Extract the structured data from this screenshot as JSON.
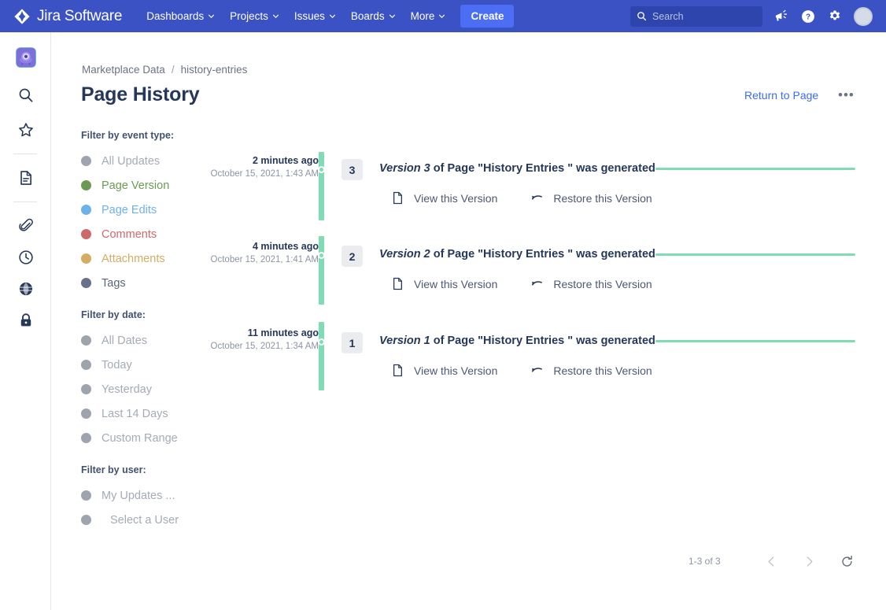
{
  "topnav": {
    "brand": "Jira Software",
    "logo_icon": "jira-diamond-logo",
    "items": [
      {
        "label": "Dashboards",
        "icon": "chevron-down-icon"
      },
      {
        "label": "Projects",
        "icon": "chevron-down-icon"
      },
      {
        "label": "Issues",
        "icon": "chevron-down-icon"
      },
      {
        "label": "Boards",
        "icon": "chevron-down-icon"
      },
      {
        "label": "More",
        "icon": "chevron-down-icon"
      }
    ],
    "create_label": "Create",
    "search": {
      "placeholder": "Search",
      "icon": "search-icon"
    },
    "right_icons": [
      {
        "name": "announcements-icon"
      },
      {
        "name": "help-icon"
      },
      {
        "name": "settings-gear-icon"
      },
      {
        "name": "user-avatar"
      }
    ],
    "bg_color": "#3a52c4",
    "create_color": "#4c6ef5"
  },
  "rail": {
    "app_logo": "app-logo",
    "items": [
      {
        "name": "search-icon"
      },
      {
        "name": "star-icon"
      },
      {
        "name": "divider"
      },
      {
        "name": "document-icon"
      },
      {
        "name": "divider"
      },
      {
        "name": "paperclip-icon"
      },
      {
        "name": "clock-icon"
      },
      {
        "name": "globe-icon"
      },
      {
        "name": "lock-icon"
      }
    ]
  },
  "header": {
    "breadcrumb": {
      "parent": "Marketplace Data",
      "separator": "/",
      "current": "history-entries"
    },
    "title": "Page History",
    "return_label": "Return to Page",
    "more_label": "•••"
  },
  "filters": {
    "event_type": {
      "title": "Filter by event type:",
      "options": [
        {
          "label": "All Updates",
          "color": "#9ea4ae",
          "text_color": "#a5abb5"
        },
        {
          "label": "Page Version",
          "color": "#6c9a54",
          "text_color": "#6c9a54"
        },
        {
          "label": "Page Edits",
          "color": "#6cb2e8",
          "text_color": "#6cb2e8"
        },
        {
          "label": "Comments",
          "color": "#cc6a6a",
          "text_color": "#cc6a6a"
        },
        {
          "label": "Attachments",
          "color": "#d6ab63",
          "text_color": "#d6ab63"
        },
        {
          "label": "Tags",
          "color": "#66728c",
          "text_color": "#5b6577"
        }
      ]
    },
    "date": {
      "title": "Filter by date:",
      "options": [
        {
          "label": "All Dates",
          "color": "#9ea4ae",
          "text_color": "#a5abb5"
        },
        {
          "label": "Today",
          "color": "#9ea4ae",
          "text_color": "#a5abb5"
        },
        {
          "label": "Yesterday",
          "color": "#9ea4ae",
          "text_color": "#a5abb5"
        },
        {
          "label": "Last 14 Days",
          "color": "#9ea4ae",
          "text_color": "#a5abb5"
        },
        {
          "label": "Custom Range",
          "color": "#9ea4ae",
          "text_color": "#a5abb5"
        }
      ]
    },
    "user": {
      "title": "Filter by user:",
      "options": [
        {
          "label": "My Updates ...",
          "color": "#9ea4ae",
          "text_color": "#a5abb5",
          "indent": false
        },
        {
          "label": "Select a User",
          "color": "#9ea4ae",
          "text_color": "#a5abb5",
          "indent": true
        }
      ]
    }
  },
  "timeline": {
    "accent_color": "#7fdcb4",
    "view_label": "View this Version",
    "restore_label": "Restore this Version",
    "view_icon": "page-document-icon",
    "restore_icon": "undo-arrow-icon",
    "entries": [
      {
        "version": "3",
        "relative_time": "2 minutes ago",
        "absolute_time": "October 15, 2021, 1:43 AM",
        "title_emphasis": "Version 3",
        "title_rest": " of Page \"History Entries \" was generated"
      },
      {
        "version": "2",
        "relative_time": "4 minutes ago",
        "absolute_time": "October 15, 2021, 1:41 AM",
        "title_emphasis": "Version 2",
        "title_rest": " of Page \"History Entries \" was generated"
      },
      {
        "version": "1",
        "relative_time": "11 minutes ago",
        "absolute_time": "October 15, 2021, 1:34 AM",
        "title_emphasis": "Version 1",
        "title_rest": " of Page \"History Entries \" was generated"
      }
    ]
  },
  "pagination": {
    "count_label": "1-3 of 3",
    "prev_icon": "chevron-left-icon",
    "next_icon": "chevron-right-icon",
    "refresh_icon": "refresh-icon"
  }
}
